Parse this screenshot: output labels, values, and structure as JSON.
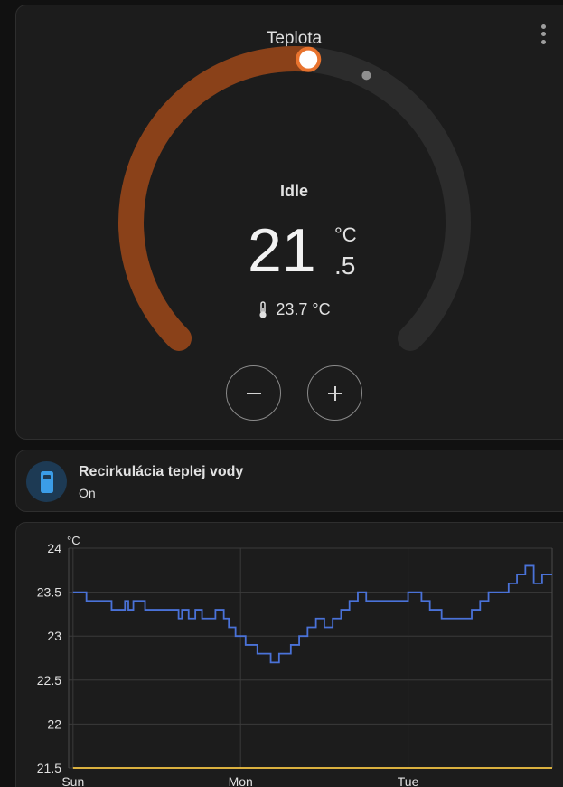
{
  "thermostat": {
    "title": "Teplota",
    "menu_icon": "dots-vertical-icon",
    "hvac_action": "Idle",
    "target_int": "21",
    "target_unit": "°C",
    "target_dec": ".5",
    "target_value": 21.5,
    "current_label": "23.7 °C",
    "current_value": 23.7,
    "current_icon": "thermometer-icon",
    "range_min": 7,
    "range_max": 35,
    "heat_color": "#e8732e",
    "arc_fill_color": "#8a4119",
    "arc_track_color": "#2c2c2c",
    "minus_icon": "minus-icon",
    "plus_icon": "plus-icon"
  },
  "switch": {
    "name": "Recirkulácia teplej vody",
    "state": "On",
    "icon": "water-heater-icon",
    "icon_color": "#3b9de8"
  },
  "history": {
    "unit": "°C",
    "y_ticks": [
      "24",
      "23.5",
      "23",
      "22.5",
      "22",
      "21.5"
    ],
    "x_ticks": [
      "Sun",
      "Mon",
      "Tue"
    ],
    "line_color": "#4a72d8",
    "target_color": "#f6c544"
  },
  "chart_data": {
    "type": "line",
    "ylabel": "°C",
    "ylim": [
      21.5,
      24
    ],
    "x_range": [
      -0.026,
      2.86
    ],
    "x_axis_ticks": [
      "Sun",
      "Mon",
      "Tue"
    ],
    "series": [
      {
        "color": "#4a72d8",
        "step": true,
        "x": [
          0.0,
          0.08,
          0.23,
          0.31,
          0.33,
          0.36,
          0.43,
          0.63,
          0.65,
          0.69,
          0.73,
          0.77,
          0.85,
          0.9,
          0.93,
          0.97,
          1.03,
          1.1,
          1.18,
          1.23,
          1.3,
          1.35,
          1.4,
          1.45,
          1.5,
          1.55,
          1.6,
          1.65,
          1.7,
          1.75,
          1.8,
          1.85,
          2.0,
          2.08,
          2.13,
          2.2,
          2.38,
          2.43,
          2.48,
          2.6,
          2.65,
          2.7,
          2.75,
          2.8,
          2.86
        ],
        "y": [
          23.5,
          23.4,
          23.3,
          23.4,
          23.3,
          23.4,
          23.3,
          23.2,
          23.3,
          23.2,
          23.3,
          23.2,
          23.3,
          23.2,
          23.1,
          23.0,
          22.9,
          22.8,
          22.7,
          22.8,
          22.9,
          23.0,
          23.1,
          23.2,
          23.1,
          23.2,
          23.3,
          23.4,
          23.5,
          23.4,
          23.4,
          23.4,
          23.5,
          23.4,
          23.3,
          23.2,
          23.3,
          23.4,
          23.5,
          23.6,
          23.7,
          23.8,
          23.6,
          23.7,
          23.7
        ]
      },
      {
        "color": "#f6c544",
        "step": true,
        "x": [
          0.0,
          2.86
        ],
        "y": [
          21.5,
          21.5
        ]
      }
    ],
    "grid": true
  }
}
